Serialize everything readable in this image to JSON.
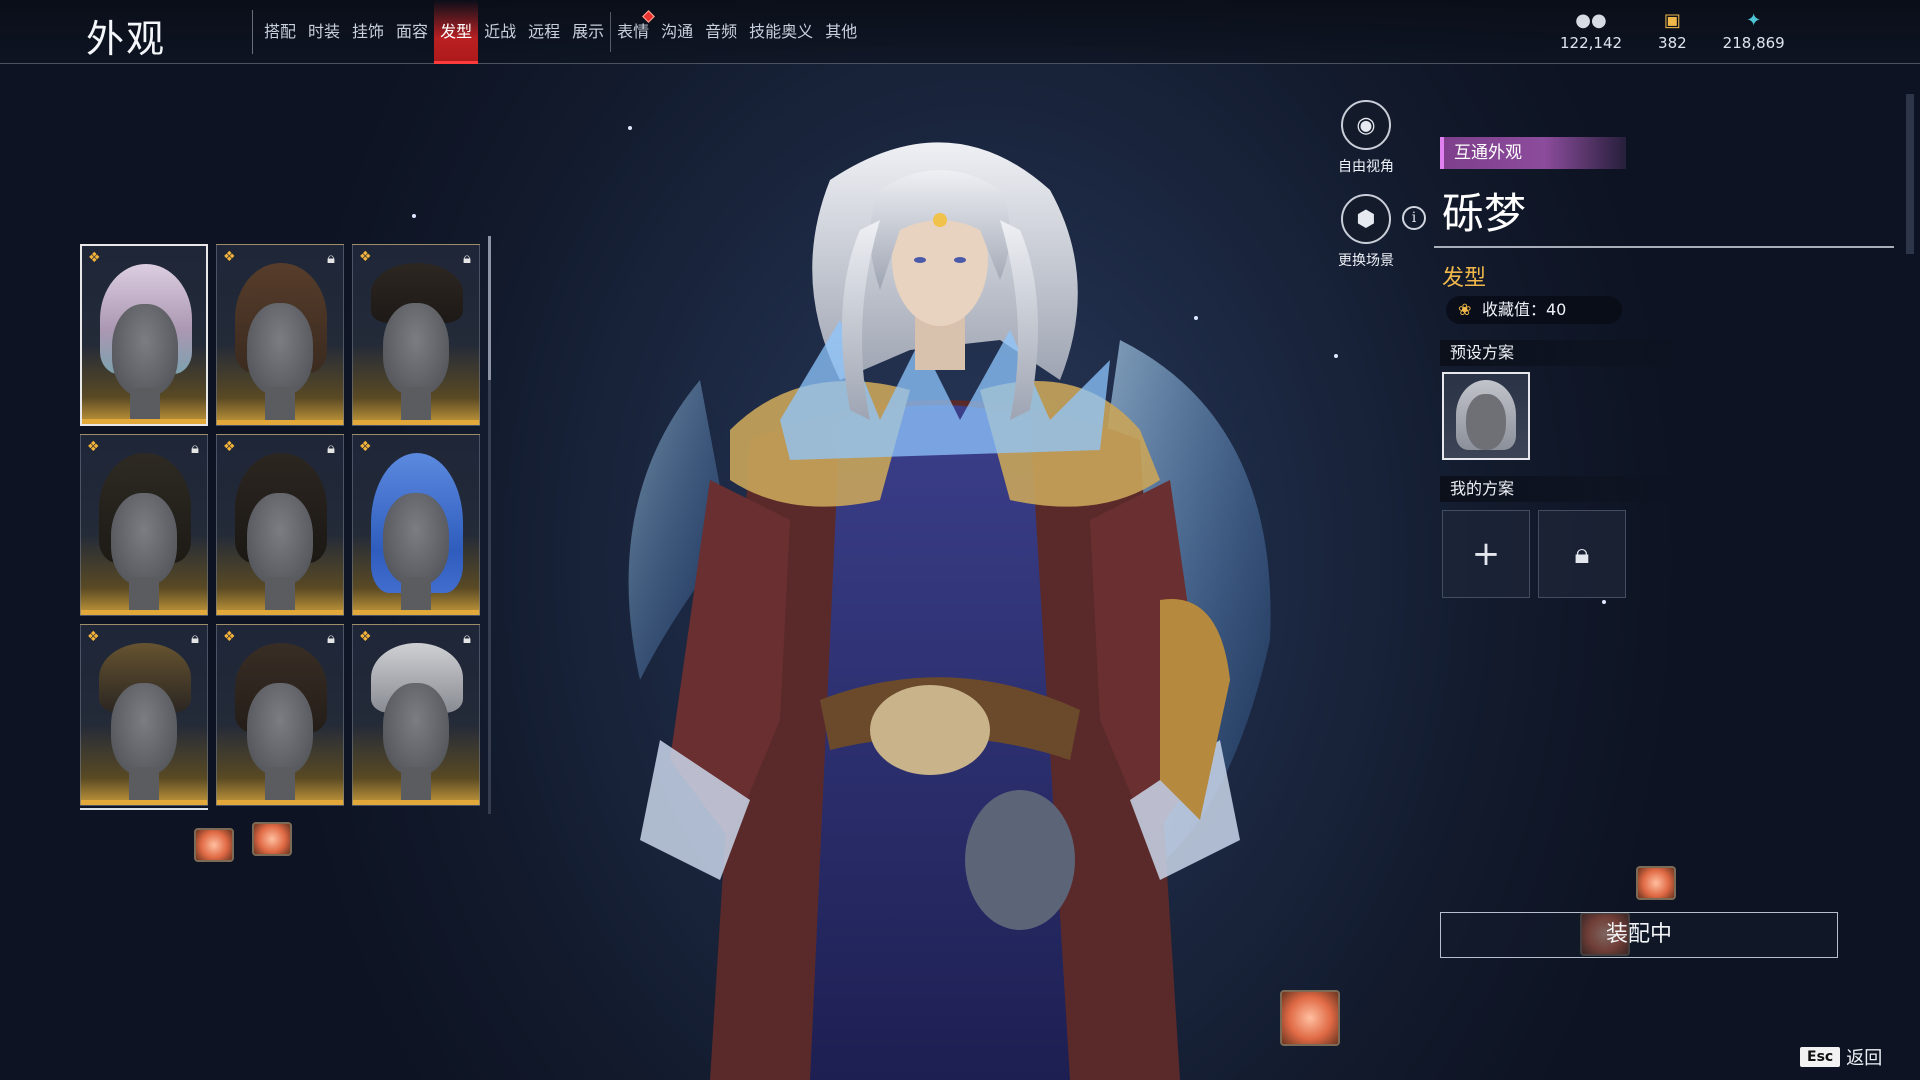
{
  "header": {
    "title": "外观",
    "tabs": [
      {
        "label": "搭配"
      },
      {
        "label": "时装"
      },
      {
        "label": "挂饰"
      },
      {
        "label": "面容"
      },
      {
        "label": "发型",
        "active": true
      },
      {
        "label": "近战"
      },
      {
        "label": "远程"
      },
      {
        "label": "展示"
      },
      {
        "label": "表情",
        "notification": true
      },
      {
        "label": "沟通"
      },
      {
        "label": "音频"
      },
      {
        "label": "技能奥义"
      },
      {
        "label": "其他"
      }
    ],
    "currencies": [
      {
        "icon": "coin-icon",
        "value": "122,142"
      },
      {
        "icon": "ticket-icon",
        "value": "382"
      },
      {
        "icon": "feather-icon",
        "value": "218,869"
      }
    ]
  },
  "hair_grid": [
    {
      "locked": false,
      "selected": true,
      "hair_color": "#d8c8dc"
    },
    {
      "locked": true,
      "hair_color": "#4a3324"
    },
    {
      "locked": true,
      "hair_color": "#2a241f"
    },
    {
      "locked": true,
      "hair_color": "#2c261f"
    },
    {
      "locked": true,
      "hair_color": "#2b2520"
    },
    {
      "locked": false,
      "hair_color": "#3a6ad0"
    },
    {
      "locked": true,
      "hair_color": "#2a2520"
    },
    {
      "locked": true,
      "hair_color": "#342a22"
    },
    {
      "locked": true,
      "hair_color": "#b9bbc0"
    }
  ],
  "actions": {
    "free_view": "自由视角",
    "change_scene": "更换场景"
  },
  "panel": {
    "cross_tag": "互通外观",
    "item_name": "砾梦",
    "category": "发型",
    "collect_label": "收藏值：40",
    "preset_header": "预设方案",
    "my_plans_header": "我的方案",
    "add_symbol": "+",
    "equip_label": "装配中"
  },
  "footer": {
    "esc_key": "Esc",
    "back_label": "返回"
  },
  "colors": {
    "accent_red": "#e8332f",
    "gold": "#f0b84a",
    "purple_tag": "#8c4c9c"
  }
}
